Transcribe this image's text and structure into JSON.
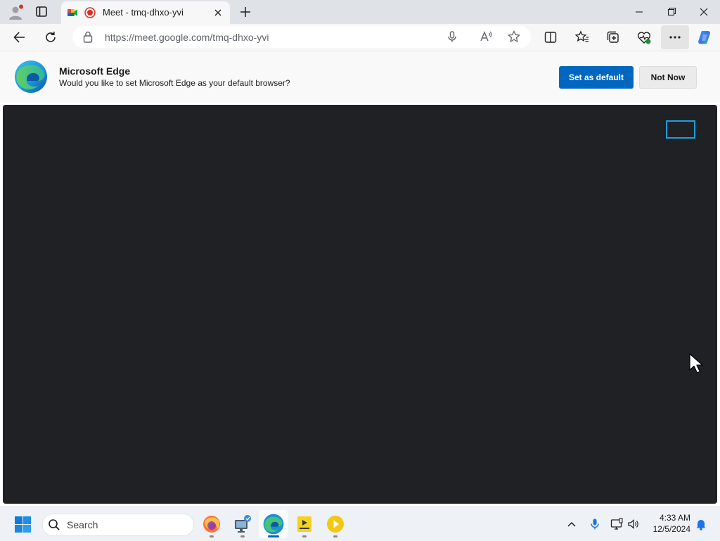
{
  "browser": {
    "tab": {
      "title": "Meet - tmq-dhxo-yvi"
    },
    "address": {
      "url": "https://meet.google.com/tmq-dhxo-yvi"
    }
  },
  "infobar": {
    "title": "Microsoft Edge",
    "message": "Would you like to set Microsoft Edge as your default browser?",
    "primary_label": "Set as default",
    "secondary_label": "Not Now"
  },
  "taskbar": {
    "search_label": "Search",
    "time": "4:33 AM",
    "date": "12/5/2024",
    "apps": [
      "firefox-icon",
      "network-tool-icon",
      "edge-icon",
      "player-icon",
      "media-play-icon"
    ]
  },
  "colors": {
    "accent": "#0067c0",
    "meet_background": "#202124",
    "focus_outline": "#1a9fe0",
    "recording_red": "#d93025"
  }
}
